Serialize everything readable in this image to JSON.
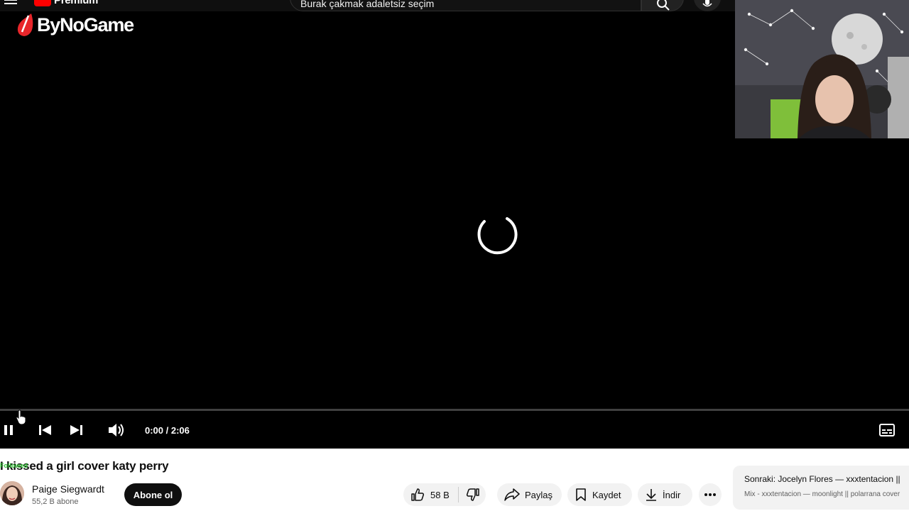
{
  "header": {
    "logo_text": "Premium",
    "search_text": "Burak çakmak adaletsiz seçim"
  },
  "watermark": {
    "text": "ByNoGame"
  },
  "player": {
    "time": "0:00 / 2:06",
    "progress": 0.0
  },
  "video": {
    "title": "I kissed a girl cover katy perry",
    "title_tag": "Followed"
  },
  "channel": {
    "name": "Paige Siegwardt",
    "subscribers": "55,2 B abone",
    "subscribe_label": "Abone ol"
  },
  "actions": {
    "like_count": "58 B",
    "share_label": "Paylaş",
    "save_label": "Kaydet",
    "download_label": "İndir"
  },
  "next_up": {
    "prefix": "Sonraki:",
    "title": "Jocelyn Flores — xxxtentacion ||",
    "subtitle": "Mix - xxxtentacion — moonlight || polarrana cover"
  },
  "colors": {
    "brand_red": "#ff0000",
    "video_bg": "#000000",
    "subscribe_bg": "#0f0f0f",
    "pill_bg": "#f2f2f2"
  }
}
